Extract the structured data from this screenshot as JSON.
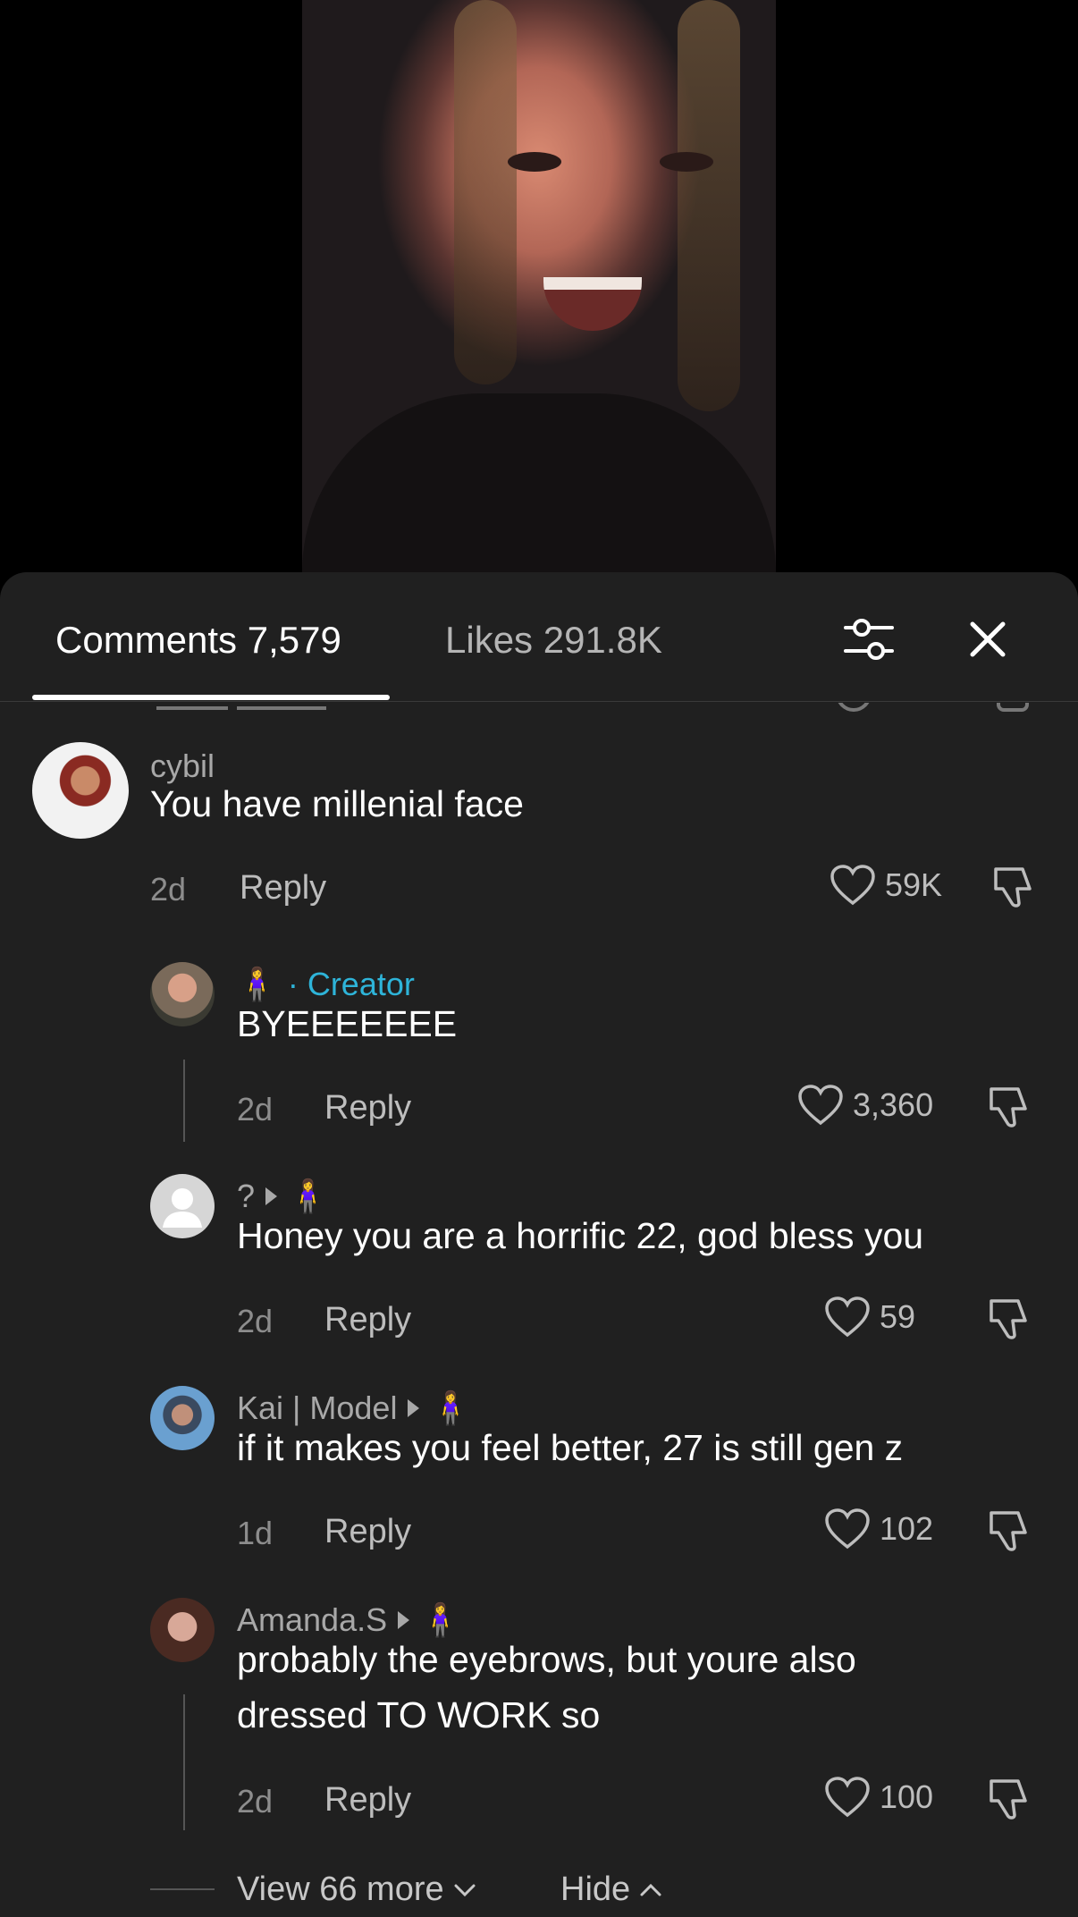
{
  "video": {},
  "tabs": {
    "comments_label": "Comments 7,579",
    "likes_label": "Likes 291.8K"
  },
  "comments": [
    {
      "username": "cybil",
      "text": "You have millenial face",
      "time": "2d",
      "reply_label": "Reply",
      "likes": "59K"
    },
    {
      "username_emoji": "🧍‍♀️",
      "creator_label": "· Creator",
      "text": "BYEEEEEEE",
      "time": "2d",
      "reply_label": "Reply",
      "likes": "3,360"
    },
    {
      "username": "?",
      "username_emoji": "🧍‍♀️",
      "text": "Honey you are a horrific 22, god bless you",
      "time": "2d",
      "reply_label": "Reply",
      "likes": "59"
    },
    {
      "username": "Kai | Model",
      "username_emoji": "🧍‍♀️",
      "text": "if it makes you feel better, 27 is still gen z",
      "time": "1d",
      "reply_label": "Reply",
      "likes": "102"
    },
    {
      "username": "Amanda.S",
      "username_emoji": "🧍‍♀️",
      "text_line1": "probably the eyebrows, but youre also",
      "text_line2": "dressed TO WORK so",
      "time": "2d",
      "reply_label": "Reply",
      "likes": "100"
    }
  ],
  "footer": {
    "view_more_label": "View 66 more",
    "hide_label": "Hide"
  }
}
